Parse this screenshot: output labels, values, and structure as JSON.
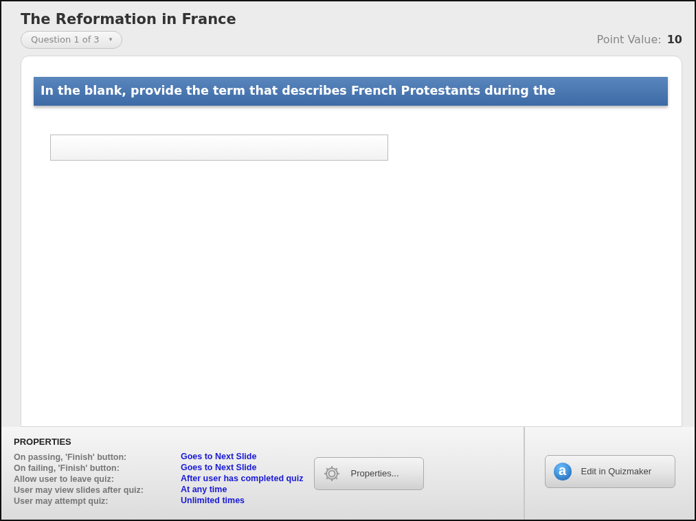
{
  "title": "The Reformation in France",
  "question_selector": {
    "label": "Question 1 of 3",
    "caret": "▾"
  },
  "point_value": {
    "label": "Point Value:",
    "value": "10"
  },
  "question": {
    "text": "In the blank, provide the term that describes French Protestants during the"
  },
  "properties": {
    "heading": "PROPERTIES",
    "rows": [
      {
        "label": "On passing, 'Finish' button:",
        "value": "Goes to Next Slide"
      },
      {
        "label": "On failing, 'Finish' button:",
        "value": "Goes to Next Slide"
      },
      {
        "label": "Allow user to leave quiz:",
        "value": "After user has completed quiz"
      },
      {
        "label": "User may view slides after quiz:",
        "value": "At any time"
      },
      {
        "label": "User may attempt quiz:",
        "value": "Unlimited times"
      }
    ]
  },
  "buttons": [
    {
      "kind": "properties",
      "label": "Properties..."
    },
    {
      "kind": "quizmaker",
      "label": "Edit in Quizmaker",
      "icon_letter": "a"
    }
  ]
}
